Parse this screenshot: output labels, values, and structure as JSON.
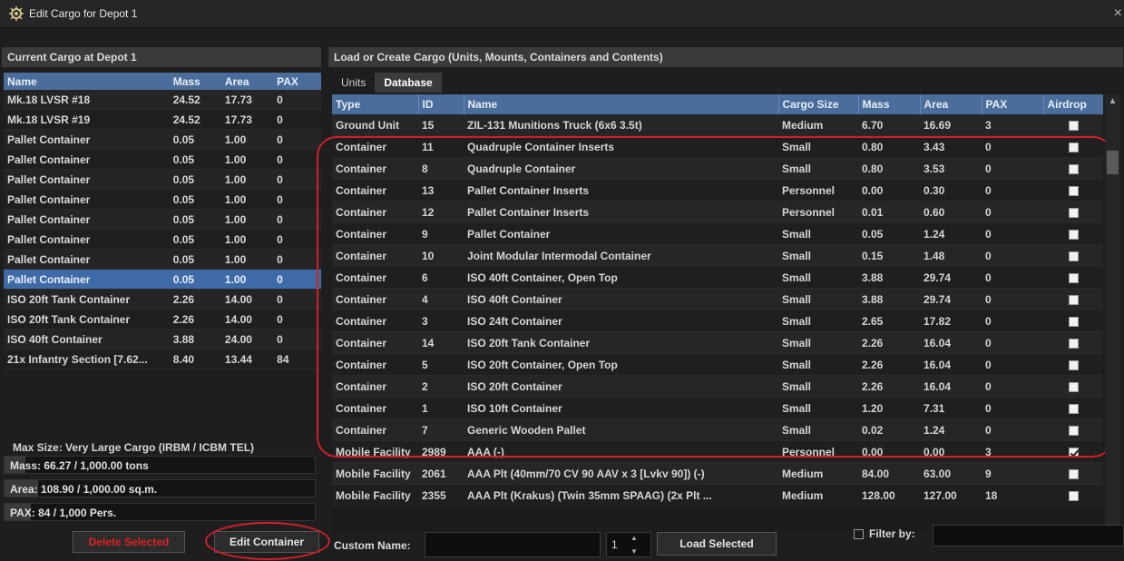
{
  "window": {
    "title": "Edit Cargo for Depot 1",
    "close_glyph": "×",
    "icon": "gear-icon"
  },
  "left": {
    "header": "Current Cargo at Depot 1",
    "columns": [
      "Name",
      "Mass",
      "Area",
      "PAX"
    ],
    "rows": [
      {
        "name": "Mk.18 LVSR #18",
        "mass": "24.52",
        "area": "17.73",
        "pax": "0",
        "selected": false
      },
      {
        "name": "Mk.18 LVSR #19",
        "mass": "24.52",
        "area": "17.73",
        "pax": "0",
        "selected": false
      },
      {
        "name": "Pallet Container",
        "mass": "0.05",
        "area": "1.00",
        "pax": "0",
        "selected": false
      },
      {
        "name": "Pallet Container",
        "mass": "0.05",
        "area": "1.00",
        "pax": "0",
        "selected": false
      },
      {
        "name": "Pallet Container",
        "mass": "0.05",
        "area": "1.00",
        "pax": "0",
        "selected": false
      },
      {
        "name": "Pallet Container",
        "mass": "0.05",
        "area": "1.00",
        "pax": "0",
        "selected": false
      },
      {
        "name": "Pallet Container",
        "mass": "0.05",
        "area": "1.00",
        "pax": "0",
        "selected": false
      },
      {
        "name": "Pallet Container",
        "mass": "0.05",
        "area": "1.00",
        "pax": "0",
        "selected": false
      },
      {
        "name": "Pallet Container",
        "mass": "0.05",
        "area": "1.00",
        "pax": "0",
        "selected": false
      },
      {
        "name": "Pallet Container",
        "mass": "0.05",
        "area": "1.00",
        "pax": "0",
        "selected": true
      },
      {
        "name": "ISO 20ft Tank Container",
        "mass": "2.26",
        "area": "14.00",
        "pax": "0",
        "selected": false
      },
      {
        "name": "ISO 20ft Tank Container",
        "mass": "2.26",
        "area": "14.00",
        "pax": "0",
        "selected": false
      },
      {
        "name": "ISO 40ft Container",
        "mass": "3.88",
        "area": "24.00",
        "pax": "0",
        "selected": false
      },
      {
        "name": "21x Infantry Section [7.62...",
        "mass": "8.40",
        "area": "13.44",
        "pax": "84",
        "selected": false
      }
    ],
    "max_size": "Max Size: Very Large Cargo (IRBM / ICBM TEL)",
    "mass_label": "Mass: 66.27 / 1,000.00 tons",
    "mass_fraction": 0.066,
    "area_label": "Area: 108.90 / 1,000.00 sq.m.",
    "area_fraction": 0.109,
    "pax_label": "PAX: 84 / 1,000 Pers.",
    "pax_fraction": 0.084,
    "delete_button": "Delete Selected",
    "edit_button": "Edit Container"
  },
  "right": {
    "header": "Load or Create Cargo (Units, Mounts, Containers and Contents)",
    "tabs": [
      {
        "label": "Units",
        "active": false
      },
      {
        "label": "Database",
        "active": true
      }
    ],
    "columns": [
      "Type",
      "ID",
      "Name",
      "Cargo Size",
      "Mass",
      "Area",
      "PAX",
      "Airdrop"
    ],
    "rows": [
      {
        "type": "Ground Unit",
        "id": "15",
        "name": "ZIL-131 Munitions Truck (6x6 3.5t)",
        "size": "Medium",
        "mass": "6.70",
        "area": "16.69",
        "pax": "3",
        "airdrop": false
      },
      {
        "type": "Container",
        "id": "11",
        "name": "Quadruple Container Inserts",
        "size": "Small",
        "mass": "0.80",
        "area": "3.43",
        "pax": "0",
        "airdrop": false
      },
      {
        "type": "Container",
        "id": "8",
        "name": "Quadruple Container",
        "size": "Small",
        "mass": "0.80",
        "area": "3.53",
        "pax": "0",
        "airdrop": false
      },
      {
        "type": "Container",
        "id": "13",
        "name": "Pallet Container Inserts",
        "size": "Personnel",
        "mass": "0.00",
        "area": "0.30",
        "pax": "0",
        "airdrop": false
      },
      {
        "type": "Container",
        "id": "12",
        "name": "Pallet Container Inserts",
        "size": "Personnel",
        "mass": "0.01",
        "area": "0.60",
        "pax": "0",
        "airdrop": false
      },
      {
        "type": "Container",
        "id": "9",
        "name": "Pallet Container",
        "size": "Small",
        "mass": "0.05",
        "area": "1.24",
        "pax": "0",
        "airdrop": false
      },
      {
        "type": "Container",
        "id": "10",
        "name": "Joint Modular Intermodal Container",
        "size": "Small",
        "mass": "0.15",
        "area": "1.48",
        "pax": "0",
        "airdrop": false
      },
      {
        "type": "Container",
        "id": "6",
        "name": "ISO 40ft Container, Open Top",
        "size": "Small",
        "mass": "3.88",
        "area": "29.74",
        "pax": "0",
        "airdrop": false
      },
      {
        "type": "Container",
        "id": "4",
        "name": "ISO 40ft Container",
        "size": "Small",
        "mass": "3.88",
        "area": "29.74",
        "pax": "0",
        "airdrop": false
      },
      {
        "type": "Container",
        "id": "3",
        "name": "ISO 24ft Container",
        "size": "Small",
        "mass": "2.65",
        "area": "17.82",
        "pax": "0",
        "airdrop": false
      },
      {
        "type": "Container",
        "id": "14",
        "name": "ISO 20ft Tank Container",
        "size": "Small",
        "mass": "2.26",
        "area": "16.04",
        "pax": "0",
        "airdrop": false
      },
      {
        "type": "Container",
        "id": "5",
        "name": "ISO 20ft Container, Open Top",
        "size": "Small",
        "mass": "2.26",
        "area": "16.04",
        "pax": "0",
        "airdrop": false
      },
      {
        "type": "Container",
        "id": "2",
        "name": "ISO 20ft Container",
        "size": "Small",
        "mass": "2.26",
        "area": "16.04",
        "pax": "0",
        "airdrop": false
      },
      {
        "type": "Container",
        "id": "1",
        "name": "ISO 10ft Container",
        "size": "Small",
        "mass": "1.20",
        "area": "7.31",
        "pax": "0",
        "airdrop": false
      },
      {
        "type": "Container",
        "id": "7",
        "name": "Generic Wooden Pallet",
        "size": "Small",
        "mass": "0.02",
        "area": "1.24",
        "pax": "0",
        "airdrop": false
      },
      {
        "type": "Mobile Facility",
        "id": "2989",
        "name": "AAA (-)",
        "size": "Personnel",
        "mass": "0.00",
        "area": "0.00",
        "pax": "3",
        "airdrop": true
      },
      {
        "type": "Mobile Facility",
        "id": "2061",
        "name": "AAA Plt (40mm/70 CV 90 AAV x 3 [Lvkv 90]) (-)",
        "size": "Medium",
        "mass": "84.00",
        "area": "63.00",
        "pax": "9",
        "airdrop": false
      },
      {
        "type": "Mobile Facility",
        "id": "2355",
        "name": "AAA Plt (Krakus) (Twin 35mm SPAAG) (2x Plt ...",
        "size": "Medium",
        "mass": "128.00",
        "area": "127.00",
        "pax": "18",
        "airdrop": false
      }
    ],
    "custom_name_label": "Custom Name:",
    "custom_name_value": "",
    "quantity": "1",
    "load_button": "Load Selected",
    "filter_label": "Filter by:",
    "filter_value": ""
  },
  "colors": {
    "header_blue": "#4a6d9c",
    "selected_row": "#3f6aa8",
    "annotation_red": "#d0202a",
    "delete_red": "#dd2222"
  }
}
